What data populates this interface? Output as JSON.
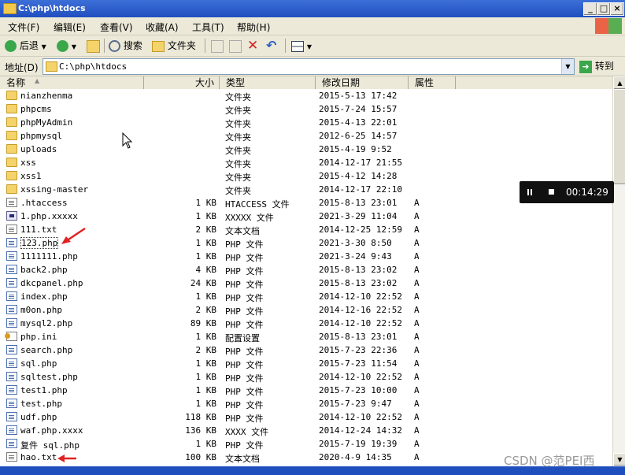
{
  "window": {
    "title": "C:\\php\\htdocs",
    "minimize_label": "_",
    "maximize_label": "□",
    "close_label": "×"
  },
  "menu": [
    "文件(F)",
    "编辑(E)",
    "查看(V)",
    "收藏(A)",
    "工具(T)",
    "帮助(H)"
  ],
  "toolbar": {
    "back_label": "后退",
    "search_label": "搜索",
    "folders_label": "文件夹"
  },
  "address": {
    "label": "地址(D)",
    "value": "C:\\php\\htdocs",
    "go_label": "转到"
  },
  "columns": {
    "name": "名称",
    "size": "大小",
    "type": "类型",
    "modified": "修改日期",
    "attributes": "属性"
  },
  "files": [
    {
      "name": "nianzhenma",
      "size": "",
      "type": "文件夹",
      "modified": "2015-5-13 17:42",
      "attr": "",
      "icon": "folder-icon"
    },
    {
      "name": "phpcms",
      "size": "",
      "type": "文件夹",
      "modified": "2015-7-24 15:57",
      "attr": "",
      "icon": "folder-icon"
    },
    {
      "name": "phpMyAdmin",
      "size": "",
      "type": "文件夹",
      "modified": "2015-4-13 22:01",
      "attr": "",
      "icon": "folder-icon"
    },
    {
      "name": "phpmysql",
      "size": "",
      "type": "文件夹",
      "modified": "2012-6-25 14:57",
      "attr": "",
      "icon": "folder-icon"
    },
    {
      "name": "uploads",
      "size": "",
      "type": "文件夹",
      "modified": "2015-4-19 9:52",
      "attr": "",
      "icon": "folder-icon"
    },
    {
      "name": "xss",
      "size": "",
      "type": "文件夹",
      "modified": "2014-12-17 21:55",
      "attr": "",
      "icon": "folder-icon"
    },
    {
      "name": "xss1",
      "size": "",
      "type": "文件夹",
      "modified": "2015-4-12 14:28",
      "attr": "",
      "icon": "folder-icon"
    },
    {
      "name": "xssing-master",
      "size": "",
      "type": "文件夹",
      "modified": "2014-12-17 22:10",
      "attr": "",
      "icon": "folder-icon"
    },
    {
      "name": ".htaccess",
      "size": "1 KB",
      "type": "HTACCESS 文件",
      "modified": "2015-8-13 23:01",
      "attr": "A",
      "icon": "file-icon"
    },
    {
      "name": "1.php.xxxxx",
      "size": "1 KB",
      "type": "XXXXX 文件",
      "modified": "2021-3-29 11:04",
      "attr": "A",
      "icon": "binary-file-icon"
    },
    {
      "name": "111.txt",
      "size": "2 KB",
      "type": "文本文档",
      "modified": "2014-12-25 12:59",
      "attr": "A",
      "icon": "text-file-icon"
    },
    {
      "name": "123.php",
      "size": "1 KB",
      "type": "PHP 文件",
      "modified": "2021-3-30 8:50",
      "attr": "A",
      "icon": "php-file-icon"
    },
    {
      "name": "1111111.php",
      "size": "1 KB",
      "type": "PHP 文件",
      "modified": "2021-3-24 9:43",
      "attr": "A",
      "icon": "php-file-icon"
    },
    {
      "name": "back2.php",
      "size": "4 KB",
      "type": "PHP 文件",
      "modified": "2015-8-13 23:02",
      "attr": "A",
      "icon": "php-file-icon"
    },
    {
      "name": "dkcpanel.php",
      "size": "24 KB",
      "type": "PHP 文件",
      "modified": "2015-8-13 23:02",
      "attr": "A",
      "icon": "php-file-icon"
    },
    {
      "name": "index.php",
      "size": "1 KB",
      "type": "PHP 文件",
      "modified": "2014-12-10 22:52",
      "attr": "A",
      "icon": "php-file-icon"
    },
    {
      "name": "m0on.php",
      "size": "2 KB",
      "type": "PHP 文件",
      "modified": "2014-12-16 22:52",
      "attr": "A",
      "icon": "php-file-icon"
    },
    {
      "name": "mysql2.php",
      "size": "89 KB",
      "type": "PHP 文件",
      "modified": "2014-12-10 22:52",
      "attr": "A",
      "icon": "php-file-icon"
    },
    {
      "name": "php.ini",
      "size": "1 KB",
      "type": "配置设置",
      "modified": "2015-8-13 23:01",
      "attr": "A",
      "icon": "config-file-icon"
    },
    {
      "name": "search.php",
      "size": "2 KB",
      "type": "PHP 文件",
      "modified": "2015-7-23 22:36",
      "attr": "A",
      "icon": "php-file-icon"
    },
    {
      "name": "sql.php",
      "size": "1 KB",
      "type": "PHP 文件",
      "modified": "2015-7-23 11:54",
      "attr": "A",
      "icon": "php-file-icon"
    },
    {
      "name": "sqltest.php",
      "size": "1 KB",
      "type": "PHP 文件",
      "modified": "2014-12-10 22:52",
      "attr": "A",
      "icon": "php-file-icon"
    },
    {
      "name": "test1.php",
      "size": "1 KB",
      "type": "PHP 文件",
      "modified": "2015-7-23 10:00",
      "attr": "A",
      "icon": "php-file-icon"
    },
    {
      "name": "test.php",
      "size": "1 KB",
      "type": "PHP 文件",
      "modified": "2015-7-23 9:47",
      "attr": "A",
      "icon": "php-file-icon"
    },
    {
      "name": "udf.php",
      "size": "118 KB",
      "type": "PHP 文件",
      "modified": "2014-12-10 22:52",
      "attr": "A",
      "icon": "php-file-icon"
    },
    {
      "name": "waf.php.xxxx",
      "size": "136 KB",
      "type": "XXXX 文件",
      "modified": "2014-12-24 14:32",
      "attr": "A",
      "icon": "php-file-icon"
    },
    {
      "name": "复件 sql.php",
      "size": "1 KB",
      "type": "PHP 文件",
      "modified": "2015-7-19 19:39",
      "attr": "A",
      "icon": "php-file-icon"
    },
    {
      "name": "hao.txt",
      "size": "100 KB",
      "type": "文本文档",
      "modified": "2020-4-9 14:35",
      "attr": "A",
      "icon": "text-file-icon"
    }
  ],
  "overlay": {
    "timer": "00:14:29"
  },
  "watermark": "CSDN @范PEI西"
}
